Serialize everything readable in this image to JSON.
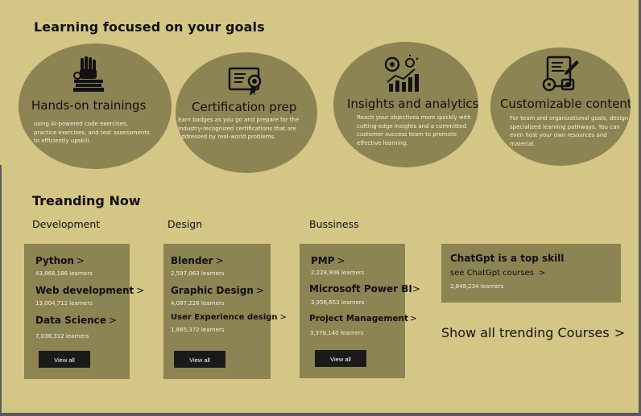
{
  "heading": "Learning focused on your goals",
  "features": [
    {
      "icon": "hands-on-training-icon",
      "title": "Hands-on trainings",
      "desc": "using AI-powered code exercises, practice exercises, and test assessments to efficiently upskill."
    },
    {
      "icon": "certificate-icon",
      "title": "Certification prep",
      "desc": "Earn badges as you go and prepare for the industry-recognized certifications that are addressed by real-world problems."
    },
    {
      "icon": "analytics-icon",
      "title": "Insights and analytics",
      "desc": "Reach your objectives more quickly with cutting-edge insights and a committed customer success team to promote effective learning."
    },
    {
      "icon": "customizable-content-icon",
      "title": "Customizable content",
      "desc": "For team and organizational goals, design specialized learning pathways. You can even host your own resources and material."
    }
  ],
  "trending": {
    "title": "Treanding Now",
    "categories": [
      "Development",
      "Design",
      "Bussiness"
    ],
    "cards": [
      {
        "items": [
          {
            "name": "Python",
            "learners": "43,868,186 learners"
          },
          {
            "name": "Web development",
            "learners": "13,004,712 learners"
          },
          {
            "name": "Data Science",
            "learners": "7,038,312 learners"
          }
        ],
        "button": "View all"
      },
      {
        "items": [
          {
            "name": "Blender",
            "learners": "2,597,063 learners"
          },
          {
            "name": "Graphic Design",
            "learners": "4,087,228 learners"
          },
          {
            "name": "User Experience design",
            "learners": "1,885,372 learners"
          }
        ],
        "button": "View all"
      },
      {
        "items": [
          {
            "name": "PMP",
            "learners": "2,228,906 learners"
          },
          {
            "name": "Microsoft Power BI",
            "learners": "3,956,653 learners"
          },
          {
            "name": "Project Management",
            "learners": "3,378,140 learners"
          }
        ],
        "button": "View all"
      }
    ],
    "chevron": ">",
    "chatgpt": {
      "title": "ChatGpt is a top skill",
      "link": "see ChatGpt courses",
      "learners": "2,848,234 learners"
    },
    "show_all": "Show all trending Courses"
  }
}
